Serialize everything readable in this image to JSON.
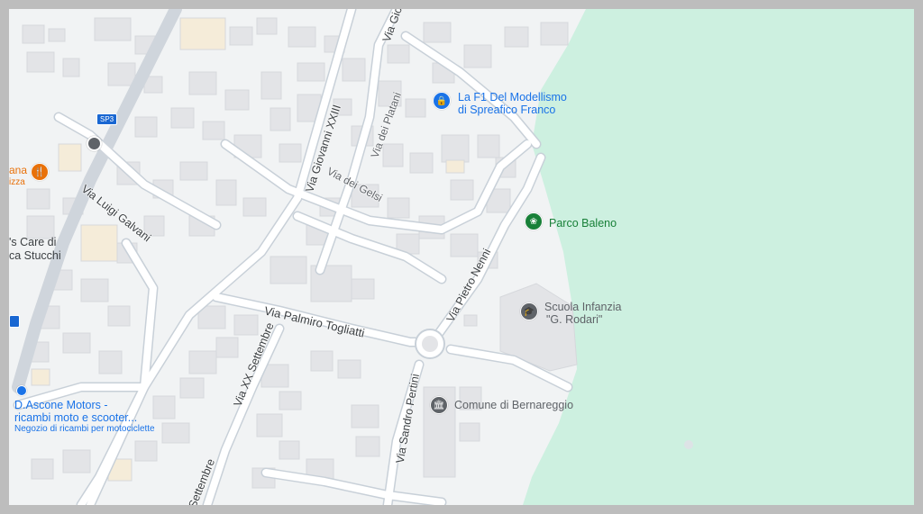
{
  "map": {
    "streets": [
      {
        "id": "via-giovanni-xxiii",
        "label": "Via Giovanni XXIII"
      },
      {
        "id": "via-gio-top",
        "label": "Via Gio"
      },
      {
        "id": "via-dei-platani",
        "label": "Via dei Platani"
      },
      {
        "id": "via-dei-gelsi",
        "label": "Via dei Gelsi"
      },
      {
        "id": "via-luigi-galvani",
        "label": "Via Luigi Galvani"
      },
      {
        "id": "via-pietro-nenni",
        "label": "Via Pietro Nenni"
      },
      {
        "id": "via-palmiro-togliatti",
        "label": "Via Palmiro Togliatti"
      },
      {
        "id": "via-xx-settembre",
        "label": "Via XX Settembre"
      },
      {
        "id": "via-sandro-pertini",
        "label": "Via Sandro Pertini"
      },
      {
        "id": "settembre-bottom",
        "label": "Settembre"
      }
    ],
    "road_badge": "SP3",
    "places": {
      "modellismo": {
        "line1": "La F1 Del Modellismo",
        "line2": "di Spreafico Franco",
        "icon": "shopping-bag-icon",
        "color": "#1a73e8"
      },
      "parco": {
        "label": "Parco Baleno",
        "icon": "park-flower-icon",
        "color": "#188038"
      },
      "scuola": {
        "line1": "Scuola Infanzia",
        "line2": "\"G. Rodari\"",
        "icon": "school-cap-icon",
        "color": "#5f6368"
      },
      "comune": {
        "label": "Comune di Bernareggio",
        "icon": "civic-building-icon",
        "color": "#5f6368"
      },
      "ascone": {
        "line1": "D.Ascone Motors -",
        "line2": "ricambi moto e scooter...",
        "sub": "Negozio di ricambi per motociclette",
        "icon": "pin-icon",
        "color": "#1a73e8"
      },
      "restaurant_partial": {
        "line1": "ana",
        "line2": "izza",
        "icon": "fork-knife-icon",
        "color": "#e8710a"
      },
      "care_partial": {
        "line1": "'s Care di",
        "line2": "ca Stucchi"
      }
    },
    "colors": {
      "park": "#cdf0e0",
      "road": "#ffffff",
      "road_outline": "#c8d0d8",
      "building": "#e3e4e7",
      "land": "#f1f3f4"
    }
  }
}
